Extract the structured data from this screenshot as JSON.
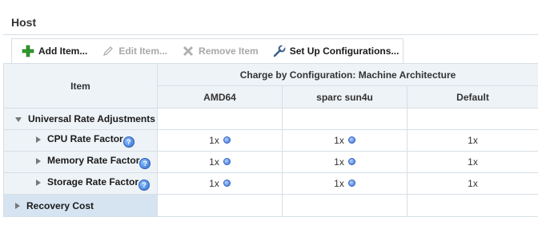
{
  "panel": {
    "title": "Host"
  },
  "toolbar": {
    "add_label": "Add Item...",
    "edit_label": "Edit Item...",
    "remove_label": "Remove Item",
    "setup_label": "Set Up Configurations..."
  },
  "table": {
    "item_header": "Item",
    "group_header": "Charge by Configuration: Machine Architecture",
    "columns": [
      "AMD64",
      "sparc sun4u",
      "Default"
    ],
    "rows": [
      {
        "label": "Universal Rate Adjustments",
        "values": [
          "",
          "",
          ""
        ]
      },
      {
        "label": "CPU Rate Factor",
        "values": [
          "1x",
          "1x",
          "1x"
        ]
      },
      {
        "label": "Memory Rate Factor",
        "values": [
          "1x",
          "1x",
          "1x"
        ]
      },
      {
        "label": "Storage Rate Factor",
        "values": [
          "1x",
          "1x",
          "1x"
        ]
      },
      {
        "label": "Recovery Cost",
        "values": [
          "",
          "",
          ""
        ]
      }
    ]
  },
  "colors": {
    "header_bg": "#eef3f7",
    "selected_row_bg": "#d6e4f1",
    "border": "#d6dfe6"
  }
}
